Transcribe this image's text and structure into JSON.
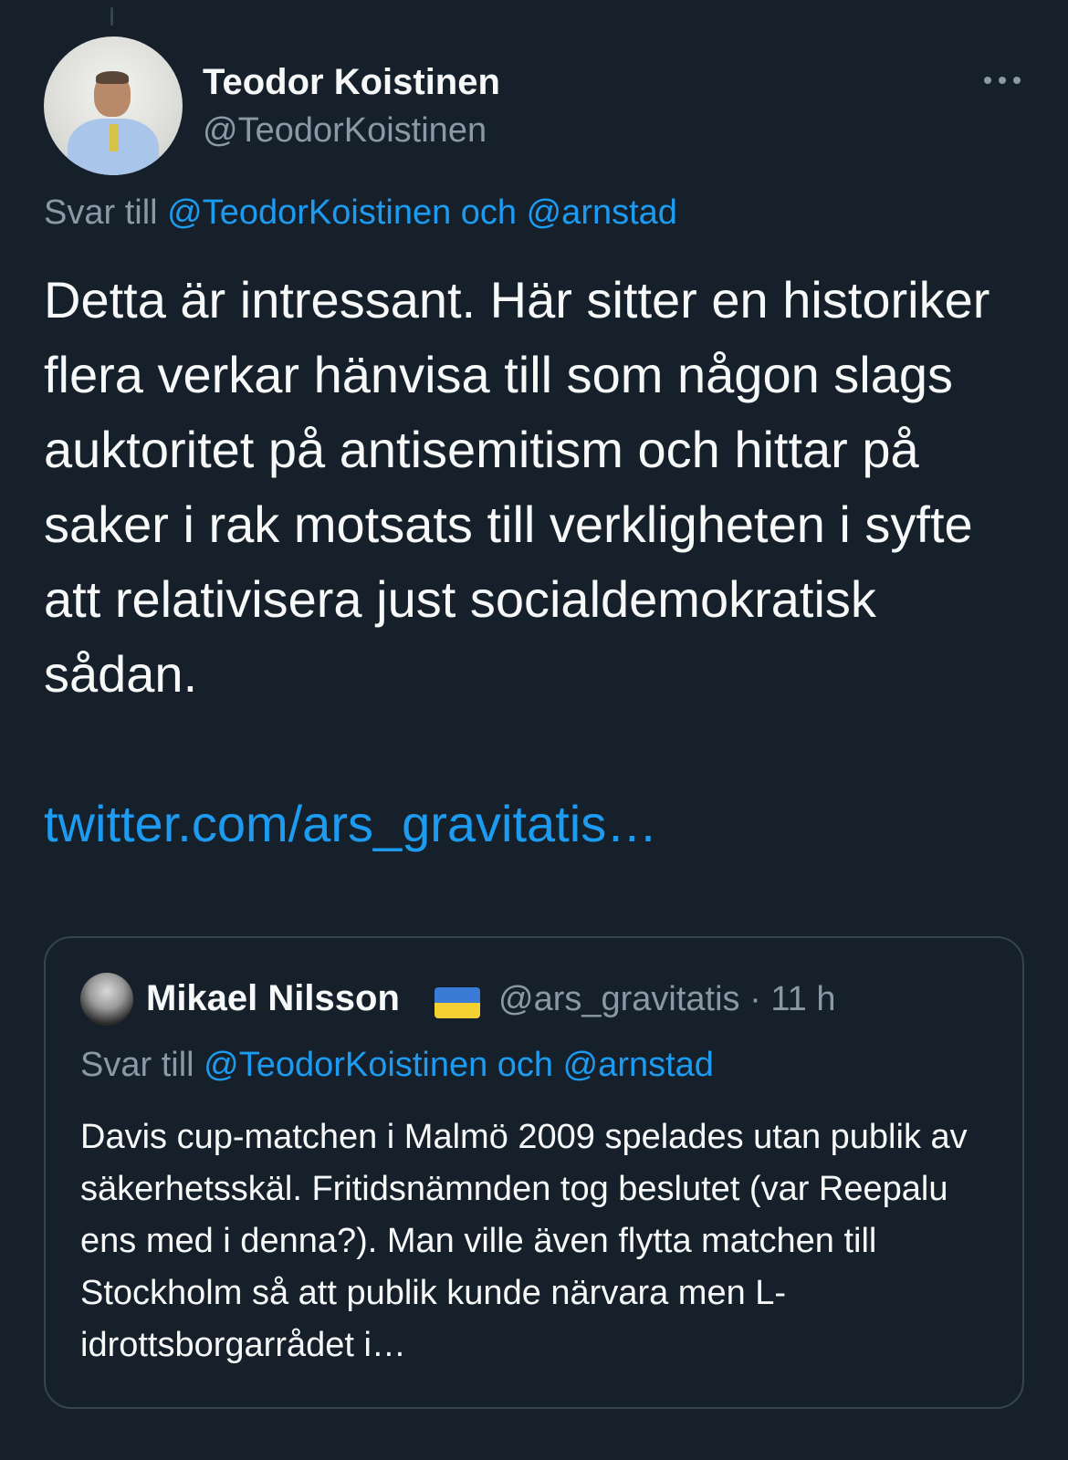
{
  "tweet": {
    "author_name": "Teodor Koistinen",
    "author_handle": "@TeodorKoistinen",
    "reply_prefix": "Svar till",
    "reply_mentions": "@TeodorKoistinen och @arnstad",
    "text": "Detta är intressant. Här sitter en historiker flera verkar hänvisa till som någon slags auktoritet på antisemitism och hittar på saker i rak motsats till verkligheten i syfte att relativisera just socialdemokratisk sådan.",
    "link": "twitter.com/ars_gravitatis…"
  },
  "quoted_tweet": {
    "author_name": "Mikael Nilsson",
    "flag": "ukraine-flag-icon",
    "author_handle": "@ars_gravitatis",
    "separator": "·",
    "time": "11 h",
    "reply_prefix": "Svar till",
    "reply_mentions": "@TeodorKoistinen och @arnstad",
    "text": "Davis cup-matchen i Malmö 2009 spelades utan publik av säkerhetsskäl. Fritidsnämnden tog beslutet (var Reepalu ens med i denna?). Man ville även flytta matchen till Stockholm så att publik kunde närvara men L-idrottsborgarrådet i…"
  },
  "colors": {
    "background": "#15202b",
    "text_primary": "#f7f9f9",
    "text_secondary": "#8b98a5",
    "link": "#1d9bf0",
    "border": "#38444d"
  }
}
